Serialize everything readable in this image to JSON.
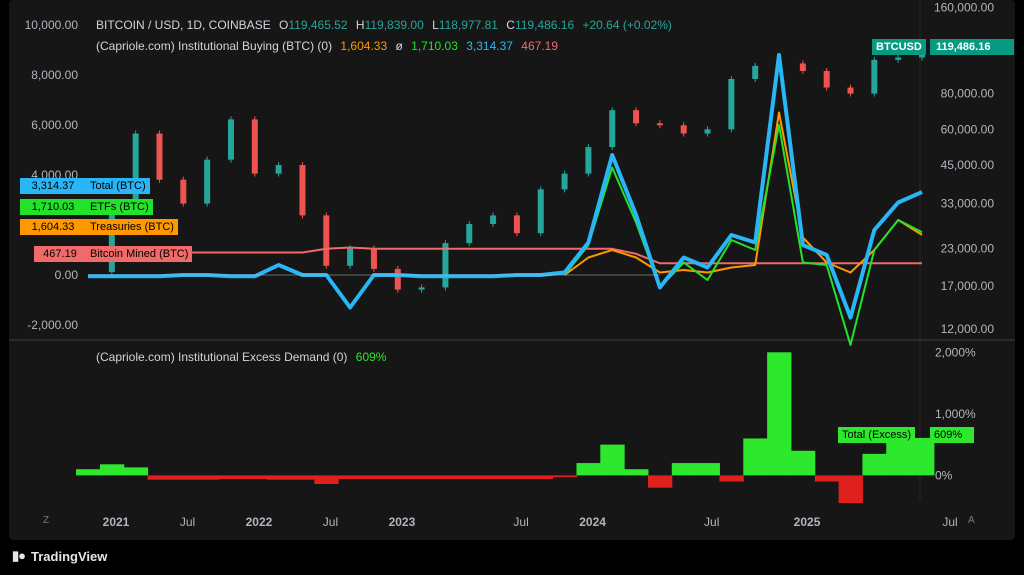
{
  "header": {
    "symbol": "BITCOIN / USD, 1D, COINBASE",
    "open_label": "O",
    "open": "119,465.52",
    "high_label": "H",
    "high": "119,839.00",
    "low_label": "L",
    "low": "118,977.81",
    "close_label": "C",
    "close": "119,486.16",
    "change": "+20.64 (+0.02%)",
    "indicator1": "(Capriole.com) Institutional Buying (BTC) (0)",
    "ind1_v1": "1,604.33",
    "ind1_sym": "ø",
    "ind1_v2": "1,710.03",
    "ind1_v3": "3,314.37",
    "ind1_v4": "467.19",
    "indicator2": "(Capriole.com) Institutional Excess Demand (0)",
    "ind2_value": "609%"
  },
  "left_axis_ticks": [
    "10,000.00",
    "8,000.00",
    "6,000.00",
    "4,000.00",
    "0.00",
    "-2,000.00"
  ],
  "right_axis_ticks": [
    "160,000.00",
    "80,000.00",
    "60,000.00",
    "45,000.00",
    "33,000.00",
    "23,000.00",
    "17,000.00",
    "12,000.00"
  ],
  "lower_axis_ticks": [
    "2,000%",
    "1,000%",
    "0%"
  ],
  "x_axis_ticks": [
    "2021",
    "Jul",
    "2022",
    "Jul",
    "2023",
    "Jul",
    "2024",
    "Jul",
    "2025",
    "Jul"
  ],
  "badges": {
    "price_symbol": "BTCUSD",
    "price_value": "119,486.16",
    "total_value": "3,314.37",
    "total_label": "Total (BTC)",
    "etf_value": "1,710.03",
    "etf_label": "ETFs (BTC)",
    "treasury_value": "1,604.33",
    "treasury_label": "Treasuries (BTC)",
    "mined_value": "467.19",
    "mined_label": "Bitcoin Mined (BTC)",
    "excess_label": "Total (Excess)",
    "excess_value": "609%"
  },
  "footer": {
    "brand": "TradingView",
    "corner_left": "Z",
    "corner_right": "A"
  },
  "colors": {
    "total": "#29b6f6",
    "etf": "#22e32a",
    "treasury": "#ff9800",
    "mined": "#f06a6a",
    "price_up": "#26a69a",
    "price_down": "#ef5350",
    "excess_pos": "#2ee82e",
    "excess_neg": "#e0201c",
    "baseline": "#c2c2c2",
    "price_badge": "#089981"
  },
  "chart_data": [
    {
      "type": "line",
      "title": "BITCOIN / USD, 1D, COINBASE — (Capriole.com) Institutional Buying (BTC)",
      "x": [
        "2020-12",
        "2021-02",
        "2021-04",
        "2021-05",
        "2021-07",
        "2021-09",
        "2021-11",
        "2022-01",
        "2022-03",
        "2022-05",
        "2022-06",
        "2022-08",
        "2022-10",
        "2022-11",
        "2023-01",
        "2023-03",
        "2023-05",
        "2023-07",
        "2023-09",
        "2023-11",
        "2024-01",
        "2024-02",
        "2024-03",
        "2024-04",
        "2024-06",
        "2024-08",
        "2024-09",
        "2024-11",
        "2024-12",
        "2025-01",
        "2025-02",
        "2025-03",
        "2025-04",
        "2025-05",
        "2025-06",
        "2025-07"
      ],
      "series": [
        {
          "name": "Total (BTC)",
          "axis": "left",
          "values": [
            -50,
            -50,
            -50,
            -50,
            0,
            0,
            -50,
            -50,
            400,
            0,
            0,
            -1300,
            0,
            0,
            -50,
            -50,
            -50,
            -50,
            0,
            0,
            100,
            1300,
            4800,
            2400,
            -500,
            700,
            300,
            1600,
            1300,
            8800,
            1200,
            800,
            -1700,
            1800,
            2900,
            3314.37
          ]
        },
        {
          "name": "ETFs (BTC)",
          "axis": "left",
          "values": [
            null,
            null,
            null,
            null,
            null,
            null,
            null,
            null,
            null,
            null,
            null,
            null,
            null,
            null,
            null,
            null,
            null,
            null,
            null,
            null,
            0,
            1200,
            4300,
            2100,
            -500,
            500,
            -200,
            1400,
            1000,
            6000,
            500,
            400,
            -2800,
            1000,
            2200,
            1710.03
          ]
        },
        {
          "name": "Treasuries (BTC)",
          "axis": "left",
          "values": [
            null,
            null,
            null,
            null,
            null,
            null,
            null,
            null,
            null,
            null,
            null,
            null,
            null,
            null,
            null,
            null,
            null,
            null,
            null,
            null,
            0,
            700,
            1000,
            700,
            100,
            200,
            100,
            300,
            400,
            6500,
            1500,
            500,
            100,
            1000,
            2200,
            1604.33
          ]
        },
        {
          "name": "Bitcoin Mined (BTC)",
          "axis": "left",
          "values": [
            900,
            900,
            900,
            900,
            900,
            900,
            900,
            900,
            900,
            900,
            1050,
            1100,
            1050,
            1050,
            1050,
            1050,
            1050,
            1050,
            1050,
            1050,
            1050,
            1050,
            1050,
            850,
            467,
            467,
            467,
            467,
            467,
            467,
            467,
            467,
            467,
            467,
            467,
            467.19
          ]
        },
        {
          "name": "BTCUSD",
          "axis": "right",
          "values": [
            19000,
            33000,
            58000,
            40000,
            33000,
            47000,
            65000,
            42000,
            45000,
            30000,
            20000,
            23000,
            19500,
            16500,
            16800,
            24000,
            28000,
            30000,
            26000,
            37000,
            42000,
            52000,
            70000,
            63000,
            62000,
            58000,
            60000,
            90000,
            100000,
            102000,
            96000,
            84000,
            80000,
            105000,
            107000,
            119486.16
          ]
        }
      ],
      "left_ylim": [
        -2600,
        11000
      ],
      "right_ylim": [
        11000,
        170000
      ],
      "right_scale": "log"
    },
    {
      "type": "area",
      "title": "(Capriole.com) Institutional Excess Demand",
      "ylabel": "%",
      "x": [
        "2020-12",
        "2021-02",
        "2021-04",
        "2021-05",
        "2021-07",
        "2021-09",
        "2021-11",
        "2022-01",
        "2022-03",
        "2022-05",
        "2022-06",
        "2022-08",
        "2022-10",
        "2022-11",
        "2023-01",
        "2023-03",
        "2023-05",
        "2023-07",
        "2023-09",
        "2023-11",
        "2024-01",
        "2024-02",
        "2024-03",
        "2024-04",
        "2024-06",
        "2024-08",
        "2024-09",
        "2024-11",
        "2024-12",
        "2025-01",
        "2025-02",
        "2025-03",
        "2025-04",
        "2025-05",
        "2025-06",
        "2025-07"
      ],
      "series": [
        {
          "name": "Total (Excess)",
          "values": [
            100,
            180,
            130,
            -70,
            -70,
            -70,
            -60,
            -60,
            -70,
            -70,
            -140,
            -60,
            -60,
            -60,
            -60,
            -60,
            -60,
            -60,
            -60,
            -60,
            -30,
            200,
            500,
            100,
            -200,
            200,
            200,
            -100,
            600,
            2000,
            400,
            -100,
            -450,
            350,
            620,
            609
          ]
        }
      ],
      "ylim": [
        -400,
        2200
      ]
    }
  ]
}
